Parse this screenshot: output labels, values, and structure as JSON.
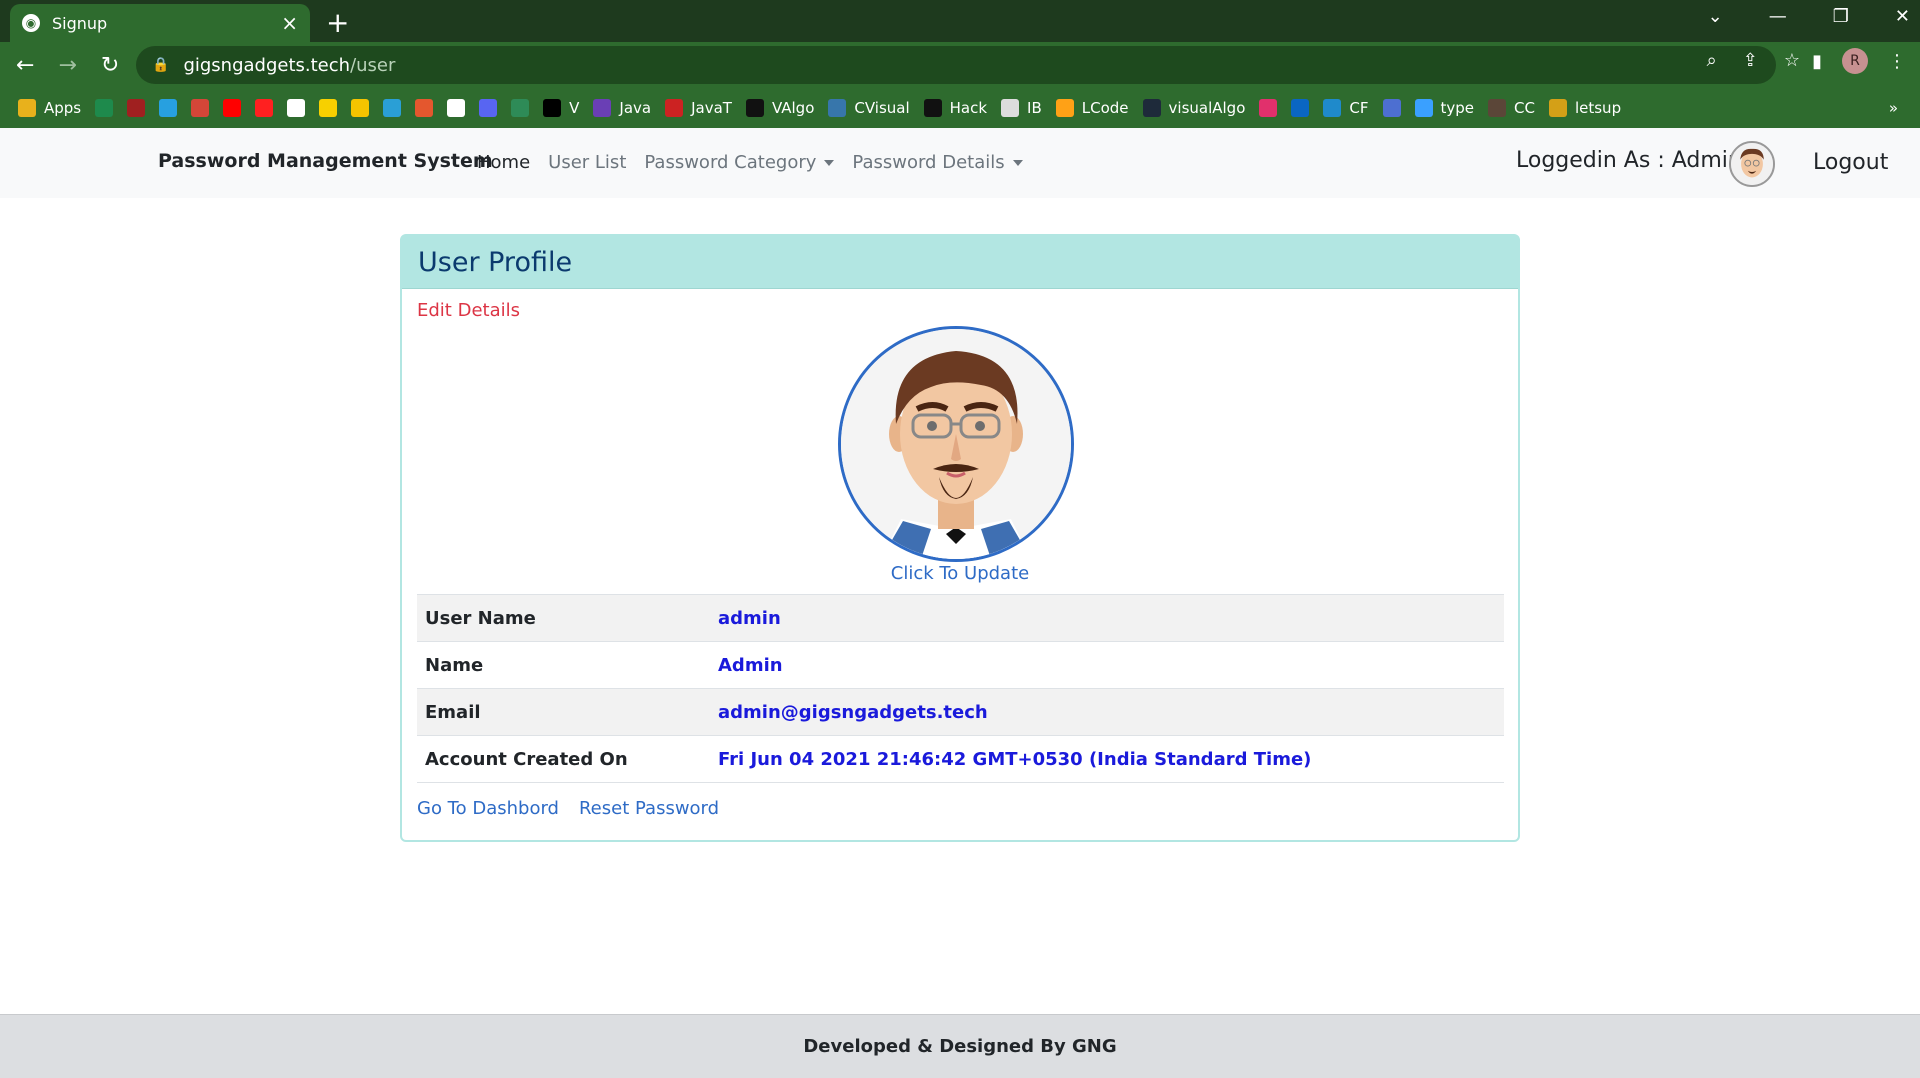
{
  "browser": {
    "tab_title": "Signup",
    "url_host": "gigsngadgets.tech",
    "url_path": "/user",
    "profile_initial": "R",
    "bookmarks": [
      {
        "label": "Apps",
        "color": "#e8b11c"
      },
      {
        "label": "",
        "color": "#1e8a4c"
      },
      {
        "label": "",
        "color": "#a02020"
      },
      {
        "label": "",
        "color": "#27a0e0"
      },
      {
        "label": "",
        "color": "#d44638"
      },
      {
        "label": "",
        "color": "#ff0000"
      },
      {
        "label": "",
        "color": "#ff2020"
      },
      {
        "label": "",
        "color": "#ffffff"
      },
      {
        "label": "",
        "color": "#f7d000"
      },
      {
        "label": "",
        "color": "#f5c400"
      },
      {
        "label": "",
        "color": "#2a9fd6"
      },
      {
        "label": "",
        "color": "#e4572e"
      },
      {
        "label": "",
        "color": "#ffffff"
      },
      {
        "label": "",
        "color": "#5865f2"
      },
      {
        "label": "",
        "color": "#2e8b57"
      },
      {
        "label": "V",
        "color": "#000000"
      },
      {
        "label": "Java",
        "color": "#6a3fb5"
      },
      {
        "label": "JavaT",
        "color": "#cc2222"
      },
      {
        "label": "VAlgo",
        "color": "#111111"
      },
      {
        "label": "CVisual",
        "color": "#3776ab"
      },
      {
        "label": "Hack",
        "color": "#111111"
      },
      {
        "label": "IB",
        "color": "#dddddd"
      },
      {
        "label": "LCode",
        "color": "#ffa116"
      },
      {
        "label": "visualAlgo",
        "color": "#1e2a3a"
      },
      {
        "label": "",
        "color": "#e1306c"
      },
      {
        "label": "",
        "color": "#0a66c2"
      },
      {
        "label": "CF",
        "color": "#1f8acb"
      },
      {
        "label": "",
        "color": "#4d6fd1"
      },
      {
        "label": "type",
        "color": "#3aa0ff"
      },
      {
        "label": "CC",
        "color": "#5b4638"
      },
      {
        "label": "letsup",
        "color": "#d4a017"
      }
    ],
    "more_bookmarks": "»"
  },
  "navbar": {
    "brand": "Password Management System",
    "links": [
      "Home",
      "User List",
      "Password Category",
      "Password Details"
    ],
    "logged_in_text": "Loggedin As : Admin",
    "logout": "Logout"
  },
  "profile": {
    "header": "User Profile",
    "edit_details": "Edit Details",
    "click_update": "Click To Update",
    "rows": [
      {
        "label": "User Name",
        "value": "admin"
      },
      {
        "label": "Name",
        "value": "Admin"
      },
      {
        "label": "Email",
        "value": "admin@gigsngadgets.tech"
      },
      {
        "label": "Account Created On",
        "value": "Fri Jun 04 2021 21:46:42 GMT+0530 (India Standard Time)"
      }
    ],
    "links": [
      "Go To Dashbord",
      "Reset Password"
    ]
  },
  "footer": {
    "text": "Developed & Designed By GNG"
  }
}
